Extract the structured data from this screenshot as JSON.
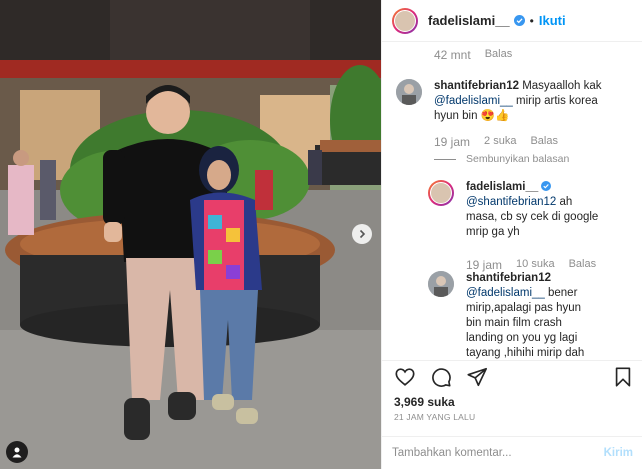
{
  "header": {
    "username": "fadelislami__",
    "separator": "•",
    "follow_label": "Ikuti"
  },
  "comments": {
    "top_meta": {
      "time": "42 mnt",
      "reply_label": "Balas"
    },
    "items": [
      {
        "username": "shantifebrian12",
        "text_lines": [
          "Masyaalloh kak",
          "mirip artis korea",
          "hyun bin 😍👍"
        ],
        "mention": "@fadelislami__",
        "time": "19 jam",
        "likes": "2 suka",
        "reply_label": "Balas"
      },
      {
        "username": "fadelislami__",
        "mention": "@shantifebrian12",
        "text_lines": [
          "ah",
          "masa, cb sy cek di google",
          "mrip ga yh"
        ],
        "time": "19 jam",
        "likes": "10 suka",
        "reply_label": "Balas"
      },
      {
        "username": "shantifebrian12",
        "mention": "@fadelislami__",
        "text_lines": [
          "bener",
          "mirip,apalagi pas hyun",
          "bin main film crash",
          "landing on you yg lagi",
          "tayang ,hihihi mirip dah"
        ]
      }
    ],
    "hide_replies_label": "Sembunyikan balasan"
  },
  "actions": {
    "likes": "3,969 suka",
    "time_ago": "21 JAM YANG LALU"
  },
  "comment_box": {
    "placeholder": "Tambahkan komentar...",
    "post_label": "Kirim"
  },
  "colors": {
    "follow": "#0095f6",
    "verified": "#3897f0",
    "muted": "#8e8e8e",
    "post_disabled": "#b2dffc"
  }
}
